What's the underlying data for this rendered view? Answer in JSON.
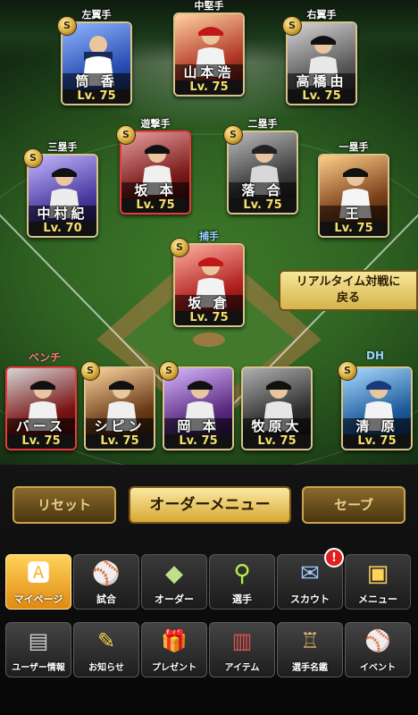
{
  "players": [
    {
      "pos": "左翼手",
      "name": "筒 香",
      "level": "Lv. 75",
      "bg": "#2a4fb3"
    },
    {
      "pos": "中堅手",
      "name": "山本浩",
      "level": "Lv. 75",
      "bg": "#b33a2a"
    },
    {
      "pos": "右翼手",
      "name": "高橋由",
      "level": "Lv. 75",
      "bg": "#5a5a5a"
    },
    {
      "pos": "遊撃手",
      "name": "坂 本",
      "level": "Lv. 75",
      "bg": "#7a1a1a"
    },
    {
      "pos": "二塁手",
      "name": "落 合",
      "level": "Lv. 75",
      "bg": "#3a3a3a"
    },
    {
      "pos": "三塁手",
      "name": "中村紀",
      "level": "Lv. 70",
      "bg": "#4a3aa0"
    },
    {
      "pos": "一塁手",
      "name": "王",
      "level": "Lv. 75",
      "bg": "#7a3f1a"
    },
    {
      "pos": "捕手",
      "name": "坂 倉",
      "level": "Lv. 75",
      "bg": "#b02020"
    }
  ],
  "bench": [
    {
      "name": "バース",
      "level": "Lv. 75",
      "bg": "#7a1414"
    },
    {
      "name": "シピン",
      "level": "Lv. 75",
      "bg": "#6a3a16"
    },
    {
      "name": "岡 本",
      "level": "Lv. 75",
      "bg": "#5a2a80"
    },
    {
      "name": "牧原大",
      "level": "Lv. 75",
      "bg": "#2c2c2c"
    }
  ],
  "dh": {
    "name": "清 原",
    "level": "Lv. 75",
    "bg": "#1e5a9c"
  },
  "labels": {
    "bench": "ベンチ",
    "dh": "DH",
    "badge": "S"
  },
  "realtime_button": {
    "line1": "リアルタイム対戦に",
    "line2": "戻る"
  },
  "buttons": {
    "reset": "リセット",
    "order_menu": "オーダーメニュー",
    "save": "セーブ"
  },
  "nav_primary": [
    {
      "label": "マイページ",
      "icon": "home-icon"
    },
    {
      "label": "試合",
      "icon": "stadium-icon"
    },
    {
      "label": "オーダー",
      "icon": "lineup-icon"
    },
    {
      "label": "選手",
      "icon": "player-icon"
    },
    {
      "label": "スカウト",
      "icon": "scout-icon",
      "notice": "!"
    },
    {
      "label": "メニュー",
      "icon": "menu-icon"
    }
  ],
  "nav_secondary": [
    {
      "label": "ユーザー情報",
      "icon": "user-info-icon"
    },
    {
      "label": "お知らせ",
      "icon": "notice-icon"
    },
    {
      "label": "プレゼント",
      "icon": "gift-icon"
    },
    {
      "label": "アイテム",
      "icon": "item-icon"
    },
    {
      "label": "選手名鑑",
      "icon": "catalog-icon"
    },
    {
      "label": "イベント",
      "icon": "event-icon"
    }
  ],
  "colors": {
    "gold": "#d7a934",
    "level_text": "#f7e06a",
    "field": "#2f6222"
  }
}
